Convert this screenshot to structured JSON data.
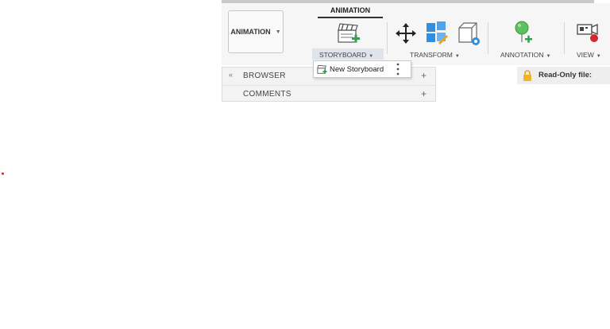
{
  "toolbar": {
    "workspace": "ANIMATION",
    "active_tab": "ANIMATION",
    "groups": {
      "storyboard": "STORYBOARD",
      "transform": "TRANSFORM",
      "annotation": "ANNOTATION",
      "view": "VIEW"
    }
  },
  "dropdown": {
    "new_storyboard": "New Storyboard"
  },
  "panel": {
    "browser": "BROWSER",
    "comments": "COMMENTS",
    "plus": "+",
    "collapse": "«"
  },
  "status": {
    "readonly": "Read-Only file:"
  },
  "colors": {
    "accent_blue": "#2f8fe0",
    "green": "#2ea34a",
    "orange": "#f0a21a",
    "red": "#d12a2a"
  },
  "icons": [
    "clapperboard-add-icon",
    "move-arrows-icon",
    "blocks-transform-icon",
    "box-view-icon",
    "pin-add-icon",
    "camera-record-icon",
    "lock-icon",
    "kebab-icon"
  ]
}
